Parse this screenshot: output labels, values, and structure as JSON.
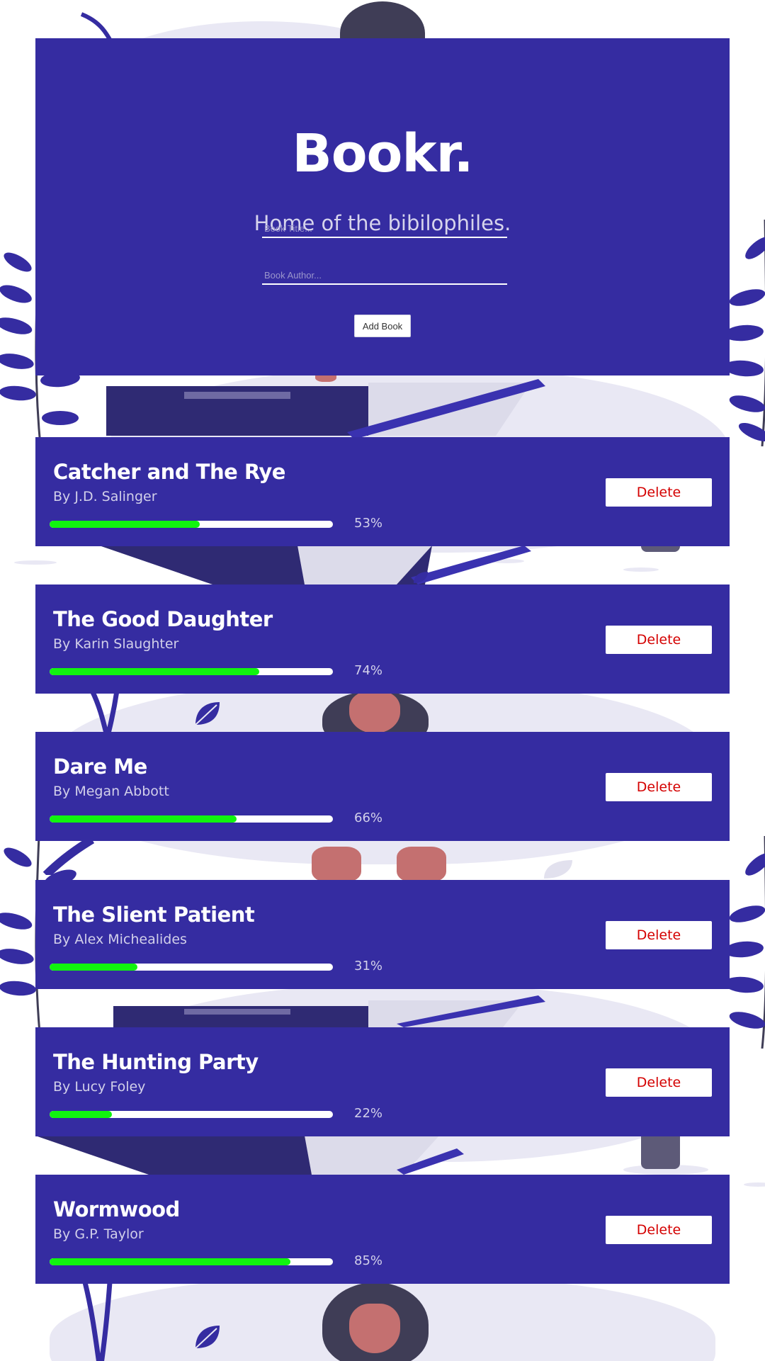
{
  "app": {
    "title": "Bookr.",
    "tagline": "Home of the bibilophiles."
  },
  "form": {
    "title_placeholder": "Book Title...",
    "author_placeholder": "Book Author...",
    "add_label": "Add Book"
  },
  "books": [
    {
      "title": "Catcher and The Rye",
      "author": "By J.D. Salinger",
      "progress": 0.53,
      "progress_label": "53%",
      "delete_label": "Delete"
    },
    {
      "title": "The Good Daughter",
      "author": "By Karin Slaughter",
      "progress": 0.74,
      "progress_label": "74%",
      "delete_label": "Delete"
    },
    {
      "title": "Dare Me",
      "author": "By Megan Abbott",
      "progress": 0.66,
      "progress_label": "66%",
      "delete_label": "Delete"
    },
    {
      "title": "The Slient Patient",
      "author": "By Alex Michealides",
      "progress": 0.31,
      "progress_label": "31%",
      "delete_label": "Delete"
    },
    {
      "title": "The Hunting Party",
      "author": "By Lucy Foley",
      "progress": 0.22,
      "progress_label": "22%",
      "delete_label": "Delete"
    },
    {
      "title": "Wormwood",
      "author": "By G.P. Taylor",
      "progress": 0.85,
      "progress_label": "85%",
      "delete_label": "Delete"
    }
  ],
  "colors": {
    "panel": "#352ca1",
    "progress_fill": "#11f40f",
    "delete_text": "#d40000",
    "illustration_lavender": "#e9e8f4",
    "illustration_dark": "#3f3d56",
    "illustration_skin": "#c47070"
  }
}
